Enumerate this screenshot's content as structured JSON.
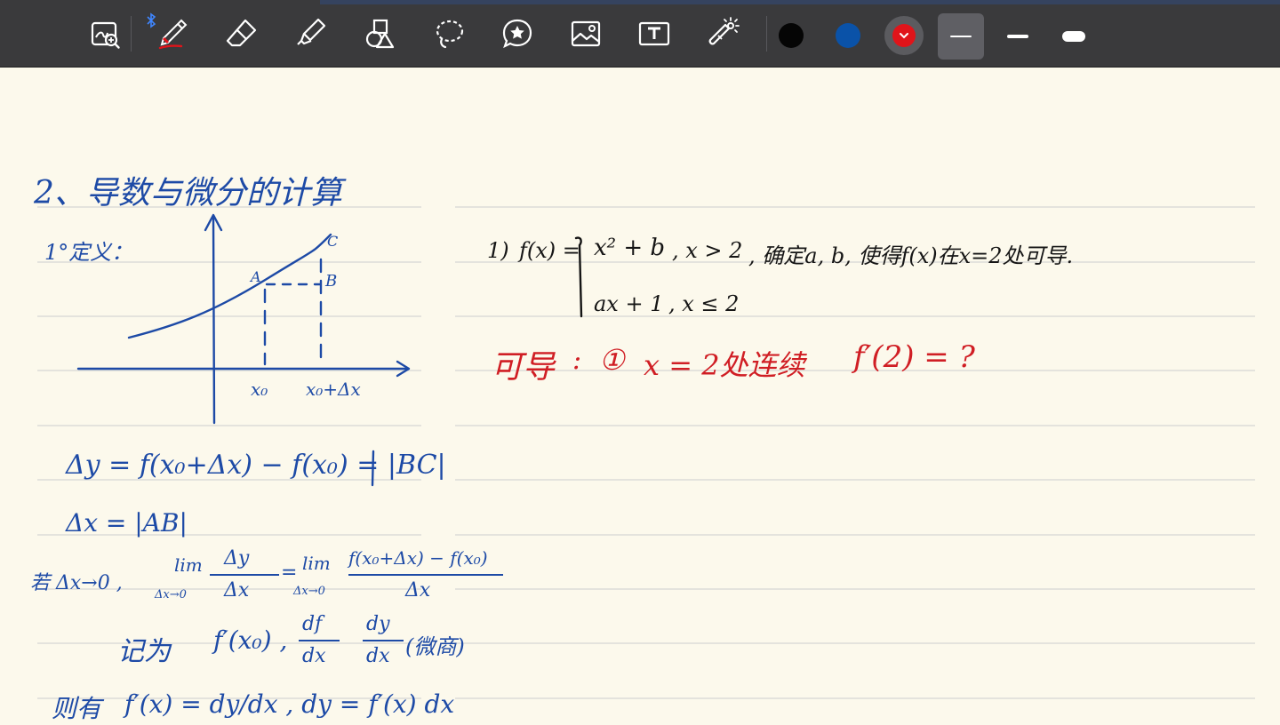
{
  "toolbar": {
    "tools": [
      {
        "name": "zoom-window-tool",
        "icon": "zoom-window-icon"
      },
      {
        "name": "pen-tool",
        "icon": "pen-icon",
        "active": true
      },
      {
        "name": "eraser-tool",
        "icon": "eraser-icon"
      },
      {
        "name": "highlighter-tool",
        "icon": "highlighter-icon"
      },
      {
        "name": "shapes-tool",
        "icon": "shapes-icon"
      },
      {
        "name": "lasso-tool",
        "icon": "lasso-icon"
      },
      {
        "name": "sticker-tool",
        "icon": "star-sticker-icon"
      },
      {
        "name": "image-tool",
        "icon": "image-icon"
      },
      {
        "name": "text-tool",
        "icon": "text-box-icon"
      },
      {
        "name": "laser-pointer-tool",
        "icon": "laser-pointer-icon"
      }
    ],
    "bluetooth_icon": "bluetooth-icon",
    "colors": [
      {
        "name": "black",
        "hex": "#050505"
      },
      {
        "name": "blue",
        "hex": "#0a52a8"
      },
      {
        "name": "red",
        "hex": "#e0141a",
        "selected": true
      }
    ],
    "stroke_widths": [
      {
        "name": "thin",
        "selected": true
      },
      {
        "name": "medium",
        "selected": false
      },
      {
        "name": "thick",
        "selected": false
      }
    ]
  },
  "notes": {
    "heading": "2、导数与微分的计算",
    "definition_label": "1°定义：",
    "graph": {
      "point_a": "A",
      "point_b": "B",
      "point_c": "C",
      "x0_label": "x₀",
      "x0_dx_label": "x₀+Δx"
    },
    "eq_dy": "Δy = f(x₀+Δx) − f(x₀) = |BC|",
    "eq_dx": "Δx = |AB|",
    "limit_prefix": "若 Δx→0 ,",
    "limit_left_lim": "lim",
    "limit_left_sub": "Δx→0",
    "limit_left_num": "Δy",
    "limit_left_den": "Δx",
    "limit_equals": "=",
    "limit_right_lim": "lim",
    "limit_right_sub": "Δx→0",
    "limit_right_num": "f(x₀+Δx) − f(x₀)",
    "limit_right_den": "Δx",
    "denote_label": "记为",
    "denote_fprime": "f′(x₀) ,",
    "denote_dfdx_num": "df",
    "denote_dfdx_den": "dx",
    "denote_dydx_num": "dy",
    "denote_dydx_den": "dx",
    "denote_note": "(微商)",
    "then_label": "则有",
    "then_expr": "f′(x) = dy/dx ,  dy = f′(x) dx",
    "problem_number": "1)",
    "problem_fx": "f(x) =",
    "case1_expr": "x² + b",
    "case1_cond": ", x > 2",
    "problem_text": ", 确定a, b, 使得f(x)在x=2处可导.",
    "case2_expr": "ax + 1",
    "case2_cond": ", x ≤ 2",
    "red_label": "可导",
    "red_colon": ":",
    "red_circled": "①",
    "red_cond1": "x = 2处连续",
    "red_cond2": "f′(2) = ?"
  }
}
